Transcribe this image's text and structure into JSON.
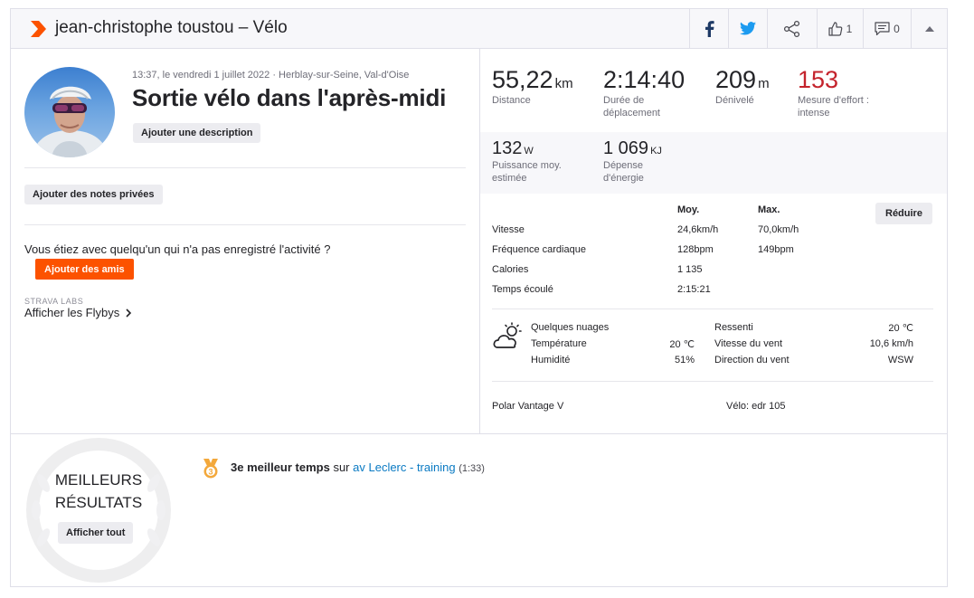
{
  "header": {
    "title": "jean-christophe toustou – Vélo",
    "kudos_count": "1",
    "comments_count": "0",
    "brand_color": "#fc5200"
  },
  "activity": {
    "meta": "13:37, le vendredi 1 juillet 2022 · Herblay-sur-Seine, Val-d'Oise",
    "title": "Sortie vélo dans l'après-midi",
    "add_description": "Ajouter une description",
    "add_private_notes": "Ajouter des notes privées",
    "with_someone_question": "Vous étiez avec quelqu'un qui n'a pas enregistré l'activité ?",
    "add_friends": "Ajouter des amis",
    "strava_labs": "STRAVA LABS",
    "flybys": "Afficher les Flybys"
  },
  "stats": {
    "distance": {
      "value": "55,22",
      "unit": "km",
      "label": "Distance"
    },
    "moving_time": {
      "value": "2:14:40",
      "label_line1": "Durée de",
      "label_line2": "déplacement"
    },
    "elevation": {
      "value": "209",
      "unit": "m",
      "label": "Dénivelé"
    },
    "effort": {
      "value": "153",
      "label_line1": "Mesure d'effort :",
      "label_line2": "intense",
      "color": "#c4232c"
    },
    "power": {
      "value": "132",
      "unit": "W",
      "label_line1": "Puissance moy.",
      "label_line2": "estimée"
    },
    "energy": {
      "value": "1 069",
      "unit": "KJ",
      "label_line1": "Dépense",
      "label_line2": "d'énergie"
    }
  },
  "details": {
    "col_avg": "Moy.",
    "col_max": "Max.",
    "collapse": "Réduire",
    "rows": [
      {
        "label": "Vitesse",
        "avg": "24,6km/h",
        "max": "70,0km/h"
      },
      {
        "label": "Fréquence cardiaque",
        "avg": "128bpm",
        "max": "149bpm"
      },
      {
        "label": "Calories",
        "avg": "1 135",
        "max": ""
      },
      {
        "label": "Temps écoulé",
        "avg": "2:15:21",
        "max": ""
      }
    ]
  },
  "weather": {
    "condition": "Quelques nuages",
    "temperature_label": "Température",
    "temperature_value": "20 ℃",
    "humidity_label": "Humidité",
    "humidity_value": "51%",
    "feels_label": "Ressenti",
    "feels_value": "20 ℃",
    "wind_speed_label": "Vitesse du vent",
    "wind_speed_value": "10,6 km/h",
    "wind_dir_label": "Direction du vent",
    "wind_dir_value": "WSW"
  },
  "gear": {
    "device": "Polar Vantage V",
    "bike": "Vélo: edr 105"
  },
  "best": {
    "title_line1": "MEILLEURS",
    "title_line2": "RÉSULTATS",
    "show_all": "Afficher tout",
    "rank_text": "3e meilleur temps",
    "on_text": "sur",
    "segment": "av Leclerc - training",
    "time": "(1:33)"
  }
}
